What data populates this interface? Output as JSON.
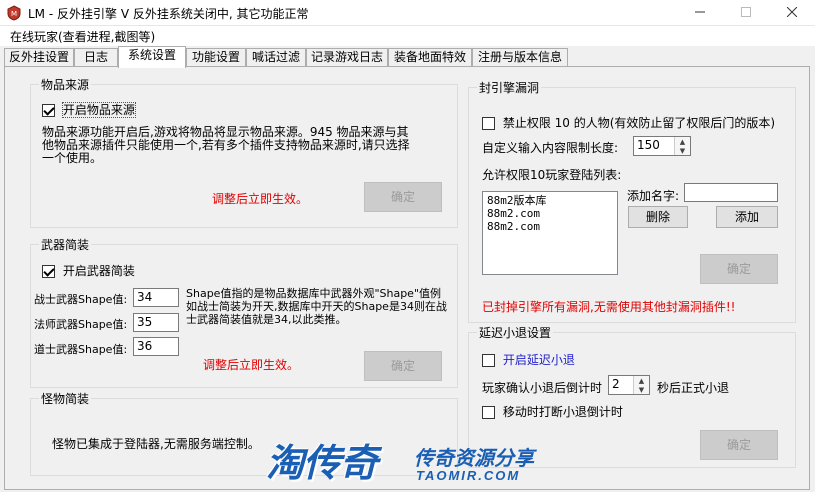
{
  "window": {
    "title": "LM - 反外挂引擎 V 反外挂系统关闭中, 其它功能正常",
    "minimize_icon": "minimize-icon",
    "maximize_icon": "maximize-icon",
    "close_icon": "close-icon"
  },
  "menu": {
    "item": "在线玩家(查看进程,截图等)"
  },
  "tabs": [
    {
      "label": "反外挂设置"
    },
    {
      "label": "日志"
    },
    {
      "label": "系统设置",
      "active": true
    },
    {
      "label": "功能设置"
    },
    {
      "label": "喊话过滤"
    },
    {
      "label": "记录游戏日志"
    },
    {
      "label": "装备地面特效"
    },
    {
      "label": "注册与版本信息"
    }
  ],
  "item_source": {
    "title": "物品来源",
    "enable_label": "开启物品来源",
    "enabled": true,
    "description": "物品来源功能开启后,游戏将物品将显示物品来源。945 物品来源与其他物品来源插件只能使用一个,若有多个插件支持物品来源时,请只选择一个使用。",
    "notice": "调整后立即生效。",
    "confirm": "确定"
  },
  "weapon": {
    "title": "武器简装",
    "enable_label": "开启武器简装",
    "enabled": true,
    "warrior_label": "战士武器Shape值:",
    "warrior_value": "34",
    "mage_label": "法师武器Shape值:",
    "mage_value": "35",
    "taoist_label": "道士武器Shape值:",
    "taoist_value": "36",
    "description": "Shape值指的是物品数据库中武器外观\"Shape\"值例如战士简装为开天,数据库中开天的Shape是34则在战士武器简装值就是34,以此类推。",
    "notice": "调整后立即生效。",
    "confirm": "确定"
  },
  "monster": {
    "title": "怪物简装",
    "text": "怪物已集成于登陆器,无需服务端控制。"
  },
  "seal": {
    "title": "封引擎漏洞",
    "ban_label": "禁止权限 10 的人物(有效防止留了权限后门的版本)",
    "ban_checked": false,
    "length_label": "自定义输入内容限制长度:",
    "length_value": "150",
    "list_label": "允许权限10玩家登陆列表:",
    "list_items": [
      "88m2版本库",
      "88m2.com",
      "88m2.com"
    ],
    "add_name_label": "添加名字:",
    "add_name_value": "",
    "delete": "删除",
    "add": "添加",
    "confirm": "确定",
    "notice": "已封掉引擎所有漏洞,无需使用其他封漏洞插件!!"
  },
  "delay": {
    "title": "延迟小退设置",
    "enable_label": "开启延迟小退",
    "enabled": false,
    "countdown_label": "玩家确认小退后倒计时",
    "countdown_value": "2",
    "countdown_suffix": "秒后正式小退",
    "move_label": "移动时打断小退倒计时",
    "move_checked": false,
    "confirm": "确定"
  },
  "watermark": {
    "main": "淘传奇",
    "sub": "传奇资源分享",
    "url": "TAOMIR.COM"
  }
}
